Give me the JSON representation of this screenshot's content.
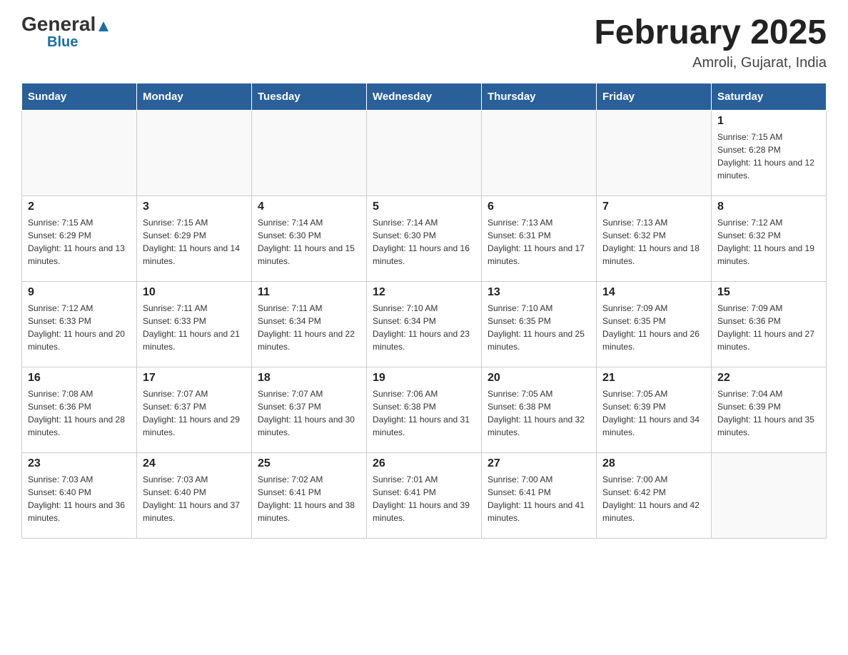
{
  "header": {
    "logo_general": "General",
    "logo_arrow": "▲",
    "logo_blue": "Blue",
    "month_title": "February 2025",
    "location": "Amroli, Gujarat, India"
  },
  "days_of_week": [
    "Sunday",
    "Monday",
    "Tuesday",
    "Wednesday",
    "Thursday",
    "Friday",
    "Saturday"
  ],
  "weeks": [
    [
      {
        "day": "",
        "info": ""
      },
      {
        "day": "",
        "info": ""
      },
      {
        "day": "",
        "info": ""
      },
      {
        "day": "",
        "info": ""
      },
      {
        "day": "",
        "info": ""
      },
      {
        "day": "",
        "info": ""
      },
      {
        "day": "1",
        "info": "Sunrise: 7:15 AM\nSunset: 6:28 PM\nDaylight: 11 hours and 12 minutes."
      }
    ],
    [
      {
        "day": "2",
        "info": "Sunrise: 7:15 AM\nSunset: 6:29 PM\nDaylight: 11 hours and 13 minutes."
      },
      {
        "day": "3",
        "info": "Sunrise: 7:15 AM\nSunset: 6:29 PM\nDaylight: 11 hours and 14 minutes."
      },
      {
        "day": "4",
        "info": "Sunrise: 7:14 AM\nSunset: 6:30 PM\nDaylight: 11 hours and 15 minutes."
      },
      {
        "day": "5",
        "info": "Sunrise: 7:14 AM\nSunset: 6:30 PM\nDaylight: 11 hours and 16 minutes."
      },
      {
        "day": "6",
        "info": "Sunrise: 7:13 AM\nSunset: 6:31 PM\nDaylight: 11 hours and 17 minutes."
      },
      {
        "day": "7",
        "info": "Sunrise: 7:13 AM\nSunset: 6:32 PM\nDaylight: 11 hours and 18 minutes."
      },
      {
        "day": "8",
        "info": "Sunrise: 7:12 AM\nSunset: 6:32 PM\nDaylight: 11 hours and 19 minutes."
      }
    ],
    [
      {
        "day": "9",
        "info": "Sunrise: 7:12 AM\nSunset: 6:33 PM\nDaylight: 11 hours and 20 minutes."
      },
      {
        "day": "10",
        "info": "Sunrise: 7:11 AM\nSunset: 6:33 PM\nDaylight: 11 hours and 21 minutes."
      },
      {
        "day": "11",
        "info": "Sunrise: 7:11 AM\nSunset: 6:34 PM\nDaylight: 11 hours and 22 minutes."
      },
      {
        "day": "12",
        "info": "Sunrise: 7:10 AM\nSunset: 6:34 PM\nDaylight: 11 hours and 23 minutes."
      },
      {
        "day": "13",
        "info": "Sunrise: 7:10 AM\nSunset: 6:35 PM\nDaylight: 11 hours and 25 minutes."
      },
      {
        "day": "14",
        "info": "Sunrise: 7:09 AM\nSunset: 6:35 PM\nDaylight: 11 hours and 26 minutes."
      },
      {
        "day": "15",
        "info": "Sunrise: 7:09 AM\nSunset: 6:36 PM\nDaylight: 11 hours and 27 minutes."
      }
    ],
    [
      {
        "day": "16",
        "info": "Sunrise: 7:08 AM\nSunset: 6:36 PM\nDaylight: 11 hours and 28 minutes."
      },
      {
        "day": "17",
        "info": "Sunrise: 7:07 AM\nSunset: 6:37 PM\nDaylight: 11 hours and 29 minutes."
      },
      {
        "day": "18",
        "info": "Sunrise: 7:07 AM\nSunset: 6:37 PM\nDaylight: 11 hours and 30 minutes."
      },
      {
        "day": "19",
        "info": "Sunrise: 7:06 AM\nSunset: 6:38 PM\nDaylight: 11 hours and 31 minutes."
      },
      {
        "day": "20",
        "info": "Sunrise: 7:05 AM\nSunset: 6:38 PM\nDaylight: 11 hours and 32 minutes."
      },
      {
        "day": "21",
        "info": "Sunrise: 7:05 AM\nSunset: 6:39 PM\nDaylight: 11 hours and 34 minutes."
      },
      {
        "day": "22",
        "info": "Sunrise: 7:04 AM\nSunset: 6:39 PM\nDaylight: 11 hours and 35 minutes."
      }
    ],
    [
      {
        "day": "23",
        "info": "Sunrise: 7:03 AM\nSunset: 6:40 PM\nDaylight: 11 hours and 36 minutes."
      },
      {
        "day": "24",
        "info": "Sunrise: 7:03 AM\nSunset: 6:40 PM\nDaylight: 11 hours and 37 minutes."
      },
      {
        "day": "25",
        "info": "Sunrise: 7:02 AM\nSunset: 6:41 PM\nDaylight: 11 hours and 38 minutes."
      },
      {
        "day": "26",
        "info": "Sunrise: 7:01 AM\nSunset: 6:41 PM\nDaylight: 11 hours and 39 minutes."
      },
      {
        "day": "27",
        "info": "Sunrise: 7:00 AM\nSunset: 6:41 PM\nDaylight: 11 hours and 41 minutes."
      },
      {
        "day": "28",
        "info": "Sunrise: 7:00 AM\nSunset: 6:42 PM\nDaylight: 11 hours and 42 minutes."
      },
      {
        "day": "",
        "info": ""
      }
    ]
  ]
}
